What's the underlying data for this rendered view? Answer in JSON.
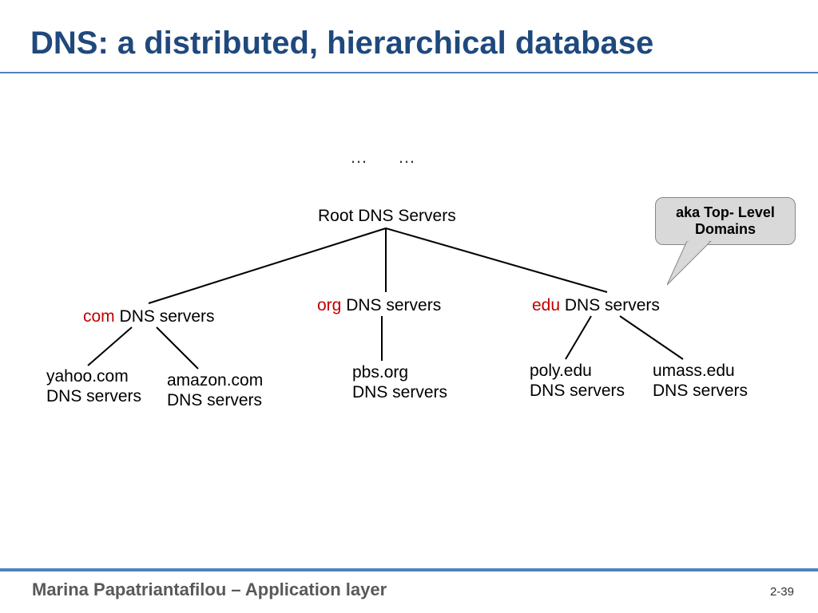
{
  "title": "DNS: a distributed, hierarchical database",
  "ellipsis1": "…",
  "ellipsis2": "…",
  "root_label": "Root DNS Servers",
  "tld": {
    "com": {
      "prefix": "com",
      "suffix": " DNS servers"
    },
    "org": {
      "prefix": "org",
      "suffix": " DNS servers"
    },
    "edu": {
      "prefix": "edu",
      "suffix": " DNS servers"
    }
  },
  "auth": {
    "yahoo": {
      "line1": "yahoo.com",
      "line2": "DNS servers"
    },
    "amazon": {
      "line1": "amazon.com",
      "line2": "DNS servers"
    },
    "pbs": {
      "line1": "pbs.org",
      "line2": "DNS servers"
    },
    "poly": {
      "line1": "poly.edu",
      "line2": "DNS servers"
    },
    "umass": {
      "line1": "umass.edu",
      "line2": "DNS servers"
    }
  },
  "callout": {
    "line1": "aka Top- Level",
    "line2": "Domains"
  },
  "footer": "Marina Papatriantafilou –  Application layer",
  "page_num": "2-39"
}
